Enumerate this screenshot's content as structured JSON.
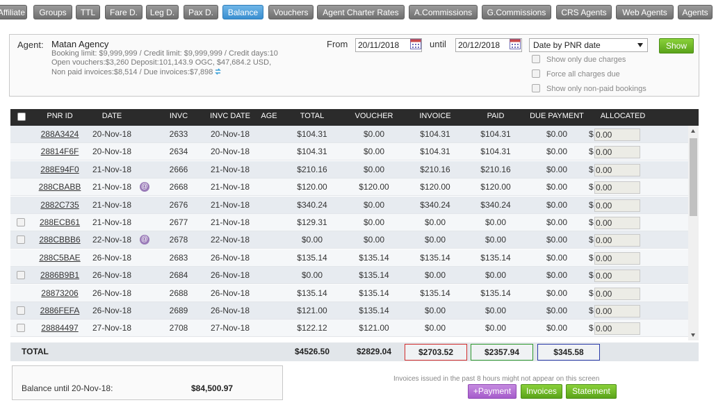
{
  "nav": {
    "tabs": [
      "Affiliate",
      "Groups",
      "TTL",
      "Fare D.",
      "Leg D.",
      "Pax D.",
      "Balance",
      "Vouchers",
      "Agent Charter Rates",
      "A.Commissions",
      "G.Commissions",
      "CRS Agents",
      "Web Agents",
      "Agents"
    ],
    "active": "Balance"
  },
  "filter": {
    "agent_label": "Agent:",
    "agent_name": "Matan Agency",
    "line1": "Booking limit: $9,999,999 /  Credit limit: $9,999,999 /  Credit days:10",
    "line2": "Open vouchers:$3,260 Deposit:101,143.9 OGC, $47,684.2 USD,",
    "line3": "Non paid invoices:$8,514 /  Due invoices:$7,898",
    "from_label": "From",
    "from_value": "20/11/2018",
    "until_label": "until",
    "until_value": "20/12/2018",
    "date_mode": "Date by PNR date",
    "show_button": "Show",
    "checkboxes": [
      "Show only due charges",
      "Force all charges due",
      "Show only non-paid bookings"
    ]
  },
  "table": {
    "columns": [
      "PNR ID",
      "DATE",
      "INVC",
      "INVC DATE",
      "AGE",
      "TOTAL",
      "VOUCHER",
      "INVOICE",
      "PAID",
      "DUE PAYMENT",
      "ALLOCATED"
    ],
    "rows": [
      {
        "check": false,
        "pnr": "288A3424",
        "date": "20-Nov-18",
        "mail": false,
        "invc": "2633",
        "invc_date": "20-Nov-18",
        "total": "$104.31",
        "voucher": "$0.00",
        "invoice": "$104.31",
        "paid": "$104.31",
        "due": "$0.00",
        "allocated": "0.00"
      },
      {
        "check": false,
        "pnr": "28814F6F",
        "date": "20-Nov-18",
        "mail": false,
        "invc": "2634",
        "invc_date": "20-Nov-18",
        "total": "$104.31",
        "voucher": "$0.00",
        "invoice": "$104.31",
        "paid": "$104.31",
        "due": "$0.00",
        "allocated": "0.00"
      },
      {
        "check": false,
        "pnr": "288E94F0",
        "date": "21-Nov-18",
        "mail": false,
        "invc": "2666",
        "invc_date": "21-Nov-18",
        "total": "$210.16",
        "voucher": "$0.00",
        "invoice": "$210.16",
        "paid": "$210.16",
        "due": "$0.00",
        "allocated": "0.00"
      },
      {
        "check": false,
        "pnr": "288CBABB",
        "date": "21-Nov-18",
        "mail": true,
        "invc": "2668",
        "invc_date": "21-Nov-18",
        "total": "$120.00",
        "voucher": "$120.00",
        "invoice": "$120.00",
        "paid": "$120.00",
        "due": "$0.00",
        "allocated": "0.00"
      },
      {
        "check": false,
        "pnr": "2882C735",
        "date": "21-Nov-18",
        "mail": false,
        "invc": "2676",
        "invc_date": "21-Nov-18",
        "total": "$340.24",
        "voucher": "$0.00",
        "invoice": "$340.24",
        "paid": "$340.24",
        "due": "$0.00",
        "allocated": "0.00"
      },
      {
        "check": true,
        "pnr": "288ECB61",
        "date": "21-Nov-18",
        "mail": false,
        "invc": "2677",
        "invc_date": "21-Nov-18",
        "total": "$129.31",
        "voucher": "$0.00",
        "invoice": "$0.00",
        "paid": "$0.00",
        "due": "$0.00",
        "allocated": "0.00"
      },
      {
        "check": true,
        "pnr": "288CBBB6",
        "date": "22-Nov-18",
        "mail": true,
        "invc": "2678",
        "invc_date": "22-Nov-18",
        "total": "$0.00",
        "voucher": "$0.00",
        "invoice": "$0.00",
        "paid": "$0.00",
        "due": "$0.00",
        "allocated": "0.00"
      },
      {
        "check": false,
        "pnr": "288C5BAE",
        "date": "26-Nov-18",
        "mail": false,
        "invc": "2683",
        "invc_date": "26-Nov-18",
        "total": "$135.14",
        "voucher": "$135.14",
        "invoice": "$135.14",
        "paid": "$135.14",
        "due": "$0.00",
        "allocated": "0.00"
      },
      {
        "check": true,
        "pnr": "2886B9B1",
        "date": "26-Nov-18",
        "mail": false,
        "invc": "2684",
        "invc_date": "26-Nov-18",
        "total": "$0.00",
        "voucher": "$135.14",
        "invoice": "$0.00",
        "paid": "$0.00",
        "due": "$0.00",
        "allocated": "0.00"
      },
      {
        "check": false,
        "pnr": "28873206",
        "date": "26-Nov-18",
        "mail": false,
        "invc": "2688",
        "invc_date": "26-Nov-18",
        "total": "$135.14",
        "voucher": "$135.14",
        "invoice": "$135.14",
        "paid": "$135.14",
        "due": "$0.00",
        "allocated": "0.00"
      },
      {
        "check": true,
        "pnr": "2886FEFA",
        "date": "26-Nov-18",
        "mail": false,
        "invc": "2689",
        "invc_date": "26-Nov-18",
        "total": "$121.00",
        "voucher": "$135.14",
        "invoice": "$0.00",
        "paid": "$0.00",
        "due": "$0.00",
        "allocated": "0.00"
      },
      {
        "check": true,
        "pnr": "28884497",
        "date": "27-Nov-18",
        "mail": false,
        "invc": "2708",
        "invc_date": "27-Nov-18",
        "total": "$122.12",
        "voucher": "$121.00",
        "invoice": "$0.00",
        "paid": "$0.00",
        "due": "$0.00",
        "allocated": "0.00"
      }
    ],
    "dollar_sign": "$",
    "mail_glyph": "@"
  },
  "totals": {
    "label": "TOTAL",
    "total": "$4526.50",
    "voucher": "$2829.04",
    "invoice": "$2703.52",
    "paid": "$2357.94",
    "due": "$345.58",
    "invoice_border": "#d22c2c",
    "paid_border": "#2e9a2e",
    "due_border": "#2a3aa8"
  },
  "balance": {
    "label": "Balance until 20-Nov-18:",
    "value": "$84,500.97"
  },
  "footer": {
    "note": "Invoices issued in the past 8 hours might not appear on this screen",
    "payment_button": "+Payment",
    "invoices_button": "Invoices",
    "statement_button": "Statement"
  }
}
